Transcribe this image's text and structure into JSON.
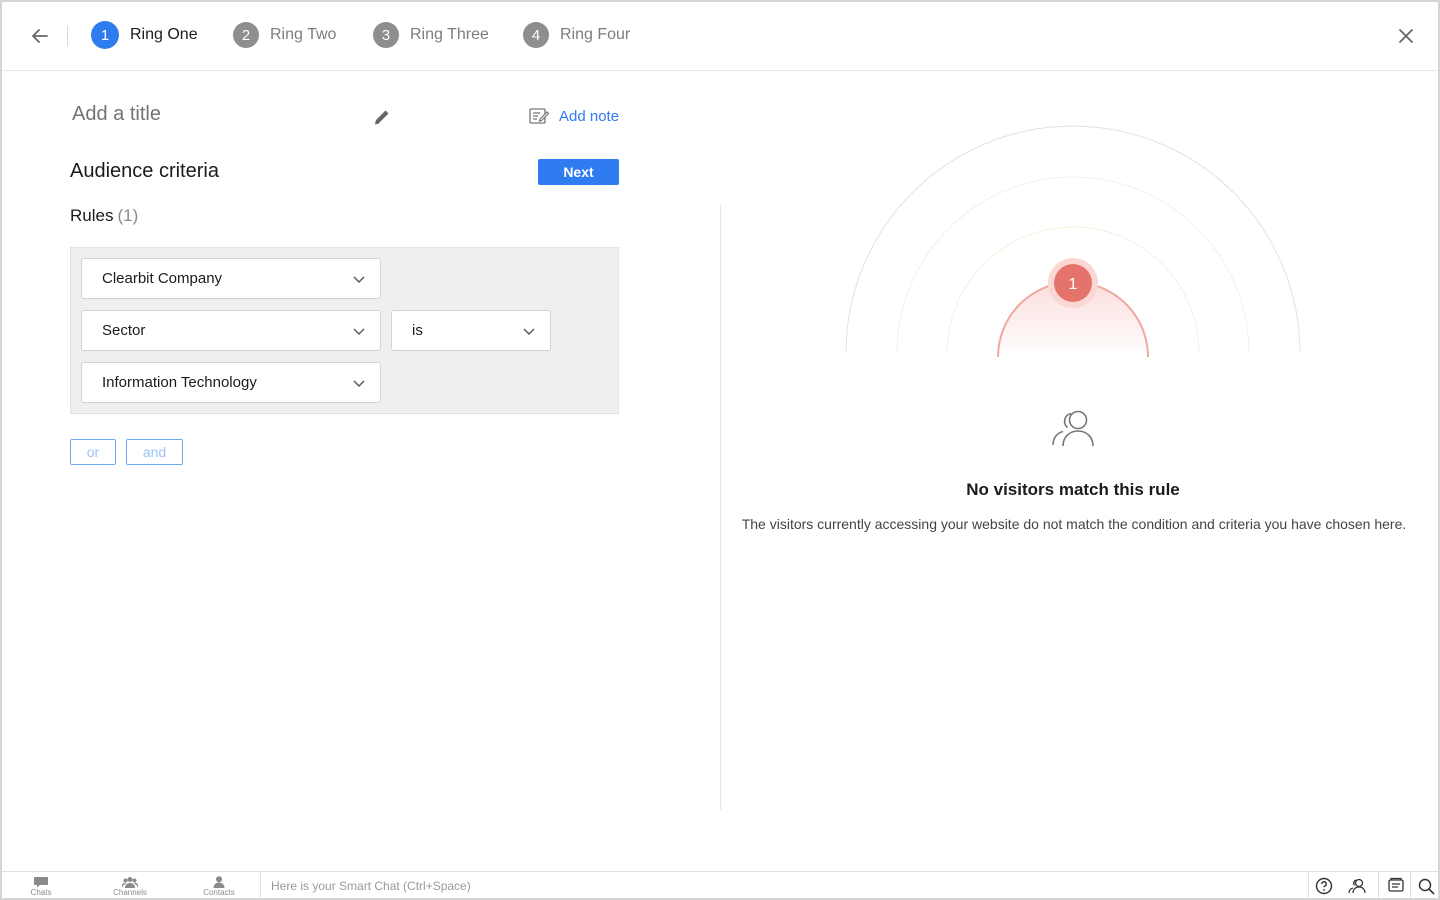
{
  "stepper": {
    "steps": [
      {
        "number": "1",
        "label": "Ring One",
        "active": true
      },
      {
        "number": "2",
        "label": "Ring Two",
        "active": false
      },
      {
        "number": "3",
        "label": "Ring Three",
        "active": false
      },
      {
        "number": "4",
        "label": "Ring Four",
        "active": false
      }
    ],
    "back_icon": "arrow-left-icon",
    "close_icon": "close-icon"
  },
  "form": {
    "title_placeholder": "Add a title",
    "add_note_label": "Add note",
    "section_title": "Audience criteria",
    "next_label": "Next",
    "rules_label": "Rules",
    "rules_count": "(1)",
    "rule": {
      "field_1": "Clearbit Company",
      "field_2": "Sector",
      "operator": "is",
      "value": "Information Technology"
    },
    "or_label": "or",
    "and_label": "and"
  },
  "preview": {
    "ring_badge": "1",
    "empty_title": "No visitors match this rule",
    "empty_description": "The visitors currently accessing your website do not match the condition and criteria you have chosen here.",
    "colors": {
      "badge": "#e4736b",
      "accent": "#2f7bf0"
    }
  },
  "bottom_bar": {
    "tabs": [
      {
        "label": "Chats",
        "icon": "chat-bubble-icon"
      },
      {
        "label": "Channels",
        "icon": "group-icon"
      },
      {
        "label": "Contacts",
        "icon": "person-icon"
      }
    ],
    "smart_chat_placeholder": "Here is your Smart Chat (Ctrl+Space)",
    "right_icons": [
      "help-icon",
      "visitors-icon",
      "feedback-icon",
      "search-icon"
    ]
  }
}
